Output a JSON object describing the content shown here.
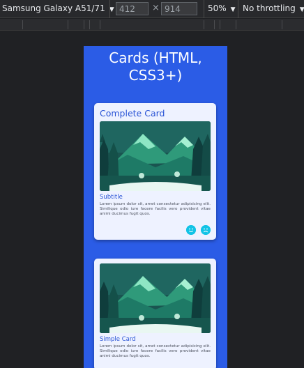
{
  "toolbar": {
    "device": "Samsung Galaxy A51/71",
    "width": "412",
    "height": "914",
    "times": "×",
    "zoom": "50%",
    "throttling": "No throttling",
    "dropdown_arrow": "▼"
  },
  "page": {
    "title": "Cards (HTML, CSS3+)"
  },
  "cards": {
    "complete": {
      "title": "Complete Card",
      "subtitle": "Subtitle",
      "text": "Lorem ipsum dolor sit, amet consectetur adipisicing elit. Similique odio iure facere facilis vero provident vitae animi ducimus fugit quos.",
      "actions": [
        "smile-icon",
        "sad-icon"
      ]
    },
    "simple": {
      "subtitle": "Simple Card",
      "text": "Lorem ipsum dolor sit, amet consectetur adipisicing elit. Similique odio iure facere facilis vero provident vitae animi ducimus fugit quos."
    }
  },
  "colors": {
    "page_background": "#2b5ce6",
    "card_background": "#eef2ff",
    "card_title": "#2b55d6",
    "action_button": "#12c3e6",
    "devtools_background": "#202124"
  }
}
